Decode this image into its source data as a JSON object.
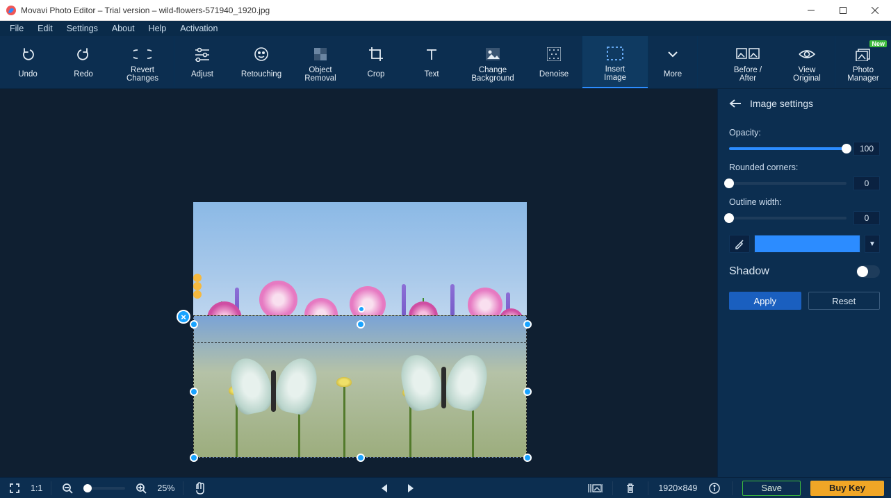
{
  "titlebar": {
    "text": "Movavi Photo Editor – Trial version – wild-flowers-571940_1920.jpg"
  },
  "menu": [
    "File",
    "Edit",
    "Settings",
    "About",
    "Help",
    "Activation"
  ],
  "toolbar": {
    "undo": "Undo",
    "redo": "Redo",
    "revert": "Revert\nChanges",
    "adjust": "Adjust",
    "retouch": "Retouching",
    "removal": "Object\nRemoval",
    "crop": "Crop",
    "text": "Text",
    "background": "Change\nBackground",
    "denoise": "Denoise",
    "insert": "Insert\nImage",
    "more": "More",
    "beforeafter": "Before /\nAfter",
    "vieworig": "View\nOriginal",
    "manager": "Photo\nManager",
    "new_badge": "New"
  },
  "panel": {
    "title": "Image settings",
    "opacity_label": "Opacity:",
    "opacity_value": "100",
    "rounded_label": "Rounded corners:",
    "rounded_value": "0",
    "outline_label": "Outline width:",
    "outline_value": "0",
    "shadow_label": "Shadow",
    "apply": "Apply",
    "reset": "Reset"
  },
  "status": {
    "ratio": "1:1",
    "zoom": "25%",
    "dimensions": "1920×849",
    "save": "Save",
    "buy": "Buy Key"
  }
}
